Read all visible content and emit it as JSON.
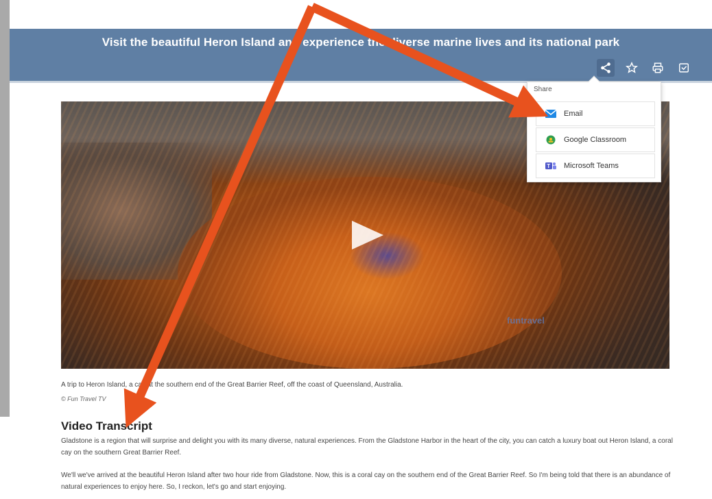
{
  "header": {
    "title": "Visit the beautiful Heron Island and experience the diverse marine lives and its national park"
  },
  "toolbar": {
    "buttons": [
      {
        "icon": "share-icon",
        "active": true
      },
      {
        "icon": "star-icon",
        "active": false
      },
      {
        "icon": "print-icon",
        "active": false
      },
      {
        "icon": "save-icon",
        "active": false
      }
    ]
  },
  "share_menu": {
    "title": "Share",
    "items": [
      {
        "label": "Email",
        "icon": "email-icon",
        "color": "#1e88e5"
      },
      {
        "label": "Google Classroom",
        "icon": "google-classroom-icon",
        "color": "#2e9e4f"
      },
      {
        "label": "Microsoft Teams",
        "icon": "microsoft-teams-icon",
        "color": "#5059c9"
      }
    ]
  },
  "video": {
    "watermark": "funtravel"
  },
  "caption": "A trip to Heron Island, a cay at the southern end of the Great Barrier Reef, off the coast of Queensland, Australia.",
  "credit": "© Fun Travel TV",
  "transcript": {
    "heading": "Video Transcript",
    "paragraph1": "Gladstone is a region that will surprise and delight you with its many diverse, natural experiences. From the Gladstone Harbor in the heart of the city, you can catch a luxury boat out Heron Island, a coral cay on the southern Great Barrier Reef.",
    "paragraph2": "We'll we've arrived at the beautiful Heron Island after two hour ride from Gladstone. Now, this is a coral cay on the southern end of the Great Barrier Reef. So I'm being told that there is an abundance of natural experiences to enjoy here. So, I reckon, let's go and start enjoying."
  },
  "colors": {
    "header_bg": "#5f7fa4",
    "arrow": "#e8521e"
  }
}
